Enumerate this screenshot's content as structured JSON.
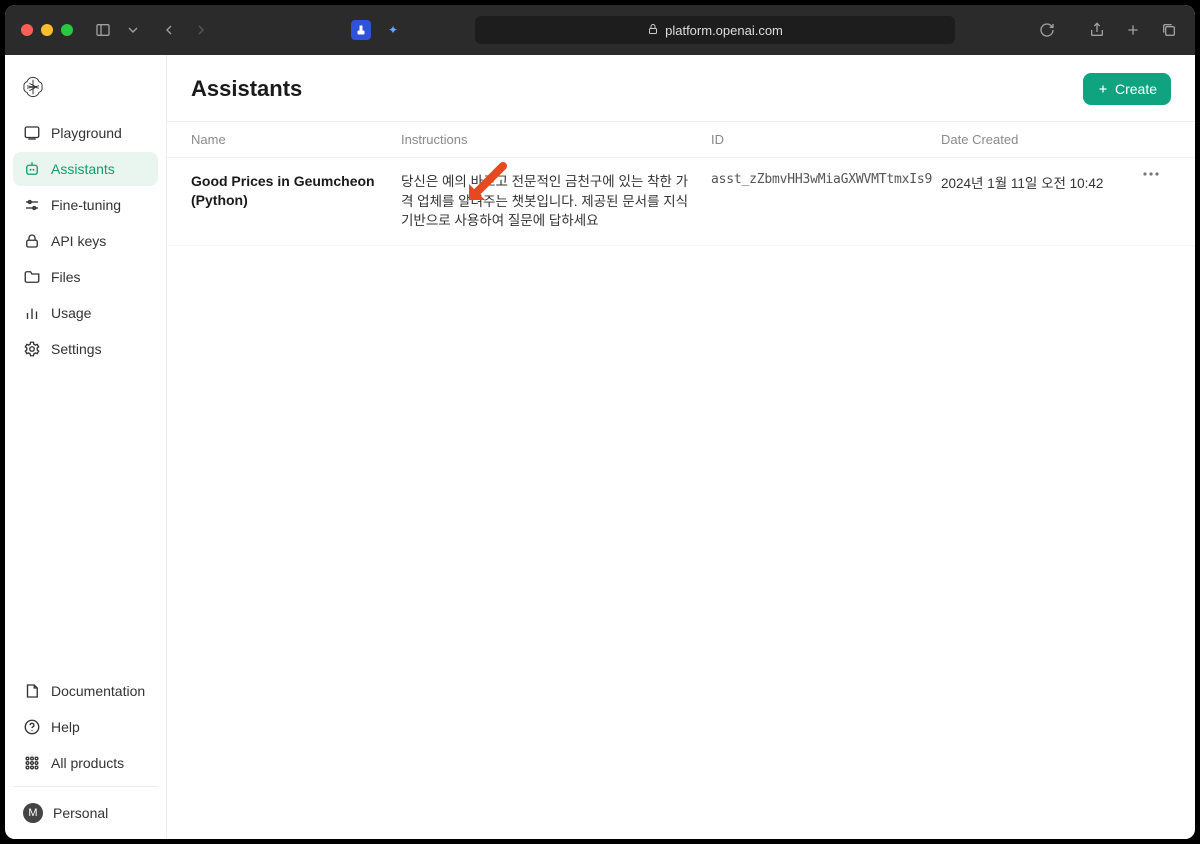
{
  "browser": {
    "url": "platform.openai.com"
  },
  "sidebar": {
    "items": [
      {
        "label": "Playground"
      },
      {
        "label": "Assistants"
      },
      {
        "label": "Fine-tuning"
      },
      {
        "label": "API keys"
      },
      {
        "label": "Files"
      },
      {
        "label": "Usage"
      },
      {
        "label": "Settings"
      }
    ],
    "bottom": [
      {
        "label": "Documentation"
      },
      {
        "label": "Help"
      },
      {
        "label": "All products"
      }
    ],
    "personal": {
      "label": "Personal",
      "avatar_initial": "M"
    }
  },
  "page": {
    "title": "Assistants",
    "create_label": "Create"
  },
  "table": {
    "columns": {
      "name": "Name",
      "instructions": "Instructions",
      "id": "ID",
      "date": "Date Created"
    },
    "rows": [
      {
        "name": "Good Prices in Geumcheon (Python)",
        "instructions": "당신은 예의 바르고 전문적인 금천구에 있는 착한 가격 업체를 알려주는 챗봇입니다. 제공된 문서를 지식 기반으로 사용하여 질문에 답하세요",
        "id": "asst_zZbmvHH3wMiaGXWVMTtmxIs9",
        "date": "2024년 1월 11일 오전 10:42"
      }
    ]
  },
  "colors": {
    "accent": "#10a37f",
    "annotation_arrow": "#e8481f"
  }
}
